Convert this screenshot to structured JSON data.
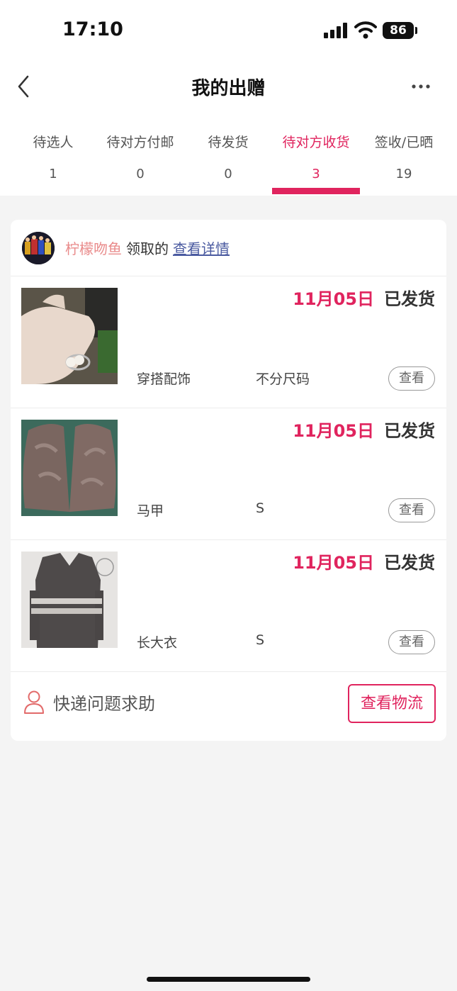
{
  "status_bar": {
    "time": "17:10",
    "battery": "86"
  },
  "header": {
    "title": "我的出赠"
  },
  "tabs": [
    {
      "label": "待选人",
      "count": "1"
    },
    {
      "label": "待对方付邮",
      "count": "0"
    },
    {
      "label": "待发货",
      "count": "0"
    },
    {
      "label": "待对方收货",
      "count": "3"
    },
    {
      "label": "签收/已晒",
      "count": "19"
    }
  ],
  "active_tab": "待对方收货",
  "card": {
    "receiver": "柠檬吻鱼",
    "claimed_text": "领取的",
    "detail_link": "查看详情",
    "items": [
      {
        "date": "11月05日",
        "status": "已发货",
        "category": "穿搭配饰",
        "size": "不分尺码",
        "button": "查看"
      },
      {
        "date": "11月05日",
        "status": "已发货",
        "category": "马甲",
        "size": "S",
        "button": "查看"
      },
      {
        "date": "11月05日",
        "status": "已发货",
        "category": "长大衣",
        "size": "S",
        "button": "查看"
      }
    ],
    "footer": {
      "help_text": "快递问题求助",
      "logistics_button": "查看物流"
    }
  },
  "colors": {
    "accent": "#e0245e",
    "receiver_name": "#e98a8a",
    "link": "#4a5aa0"
  }
}
